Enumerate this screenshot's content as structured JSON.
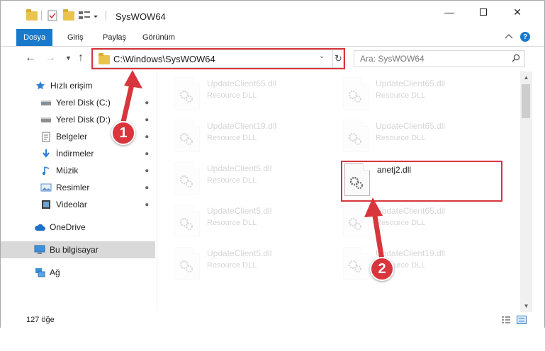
{
  "titlebar": {
    "title": "SysWOW64",
    "minimize_icon": "minimize-icon",
    "maximize_icon": "maximize-icon",
    "close_icon": "close-icon"
  },
  "ribbon": {
    "tabs": [
      {
        "label": "Dosya",
        "active": true
      },
      {
        "label": "Giriş",
        "active": false
      },
      {
        "label": "Paylaş",
        "active": false
      },
      {
        "label": "Görünüm",
        "active": false
      }
    ],
    "help_label": "?"
  },
  "nav": {
    "address": "C:\\Windows\\SysWOW64",
    "search_placeholder": "Ara: SysWOW64"
  },
  "sidebar": {
    "items": [
      {
        "label": "Hızlı erişim",
        "icon": "star-icon"
      },
      {
        "label": "Yerel Disk (C:)",
        "icon": "drive-icon"
      },
      {
        "label": "Yerel Disk (D:)",
        "icon": "drive-icon"
      },
      {
        "label": "Belgeler",
        "icon": "documents-icon"
      },
      {
        "label": "İndirmeler",
        "icon": "download-icon"
      },
      {
        "label": "Müzik",
        "icon": "music-icon"
      },
      {
        "label": "Resimler",
        "icon": "pictures-icon"
      },
      {
        "label": "Videolar",
        "icon": "videos-icon"
      },
      {
        "label": "OneDrive",
        "icon": "cloud-icon"
      },
      {
        "label": "Bu bilgisayar",
        "icon": "computer-icon"
      },
      {
        "label": "Ağ",
        "icon": "network-icon"
      }
    ]
  },
  "files": [
    {
      "name": "UpdateClient65.dll",
      "type": "Resource DLL"
    },
    {
      "name": "UpdateClient65.dll",
      "type": "Resource DLL"
    },
    {
      "name": "UpdateClient19.dll",
      "type": "Resource DLL"
    },
    {
      "name": "UpdateClient65.dll",
      "type": "Resource DLL"
    },
    {
      "name": "UpdateClient5.dll",
      "type": "Resource DLL"
    },
    {
      "name": "anetj2.dll",
      "type": ""
    },
    {
      "name": "UpdateClient5.dll",
      "type": "Resource DLL"
    },
    {
      "name": "UpdateClient65.dll",
      "type": "Resource DLL"
    },
    {
      "name": "UpdateClient5.dll",
      "type": "Resource DLL"
    },
    {
      "name": "UpdateClient19.dll",
      "type": "Resource DLL"
    }
  ],
  "status": {
    "count": "127 öğe"
  },
  "callouts": [
    "1",
    "2"
  ],
  "colors": {
    "accent": "#1979ca",
    "highlight": "#d8353d",
    "selected_nav": "#d9d9d9"
  }
}
